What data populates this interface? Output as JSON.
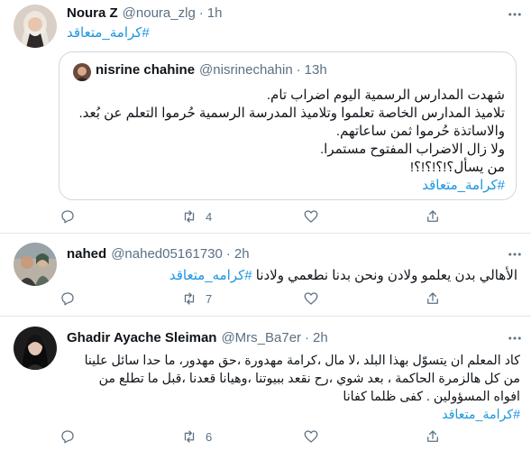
{
  "tweets": [
    {
      "name": "Noura Z",
      "handle": "@noura_zlg",
      "dot": "·",
      "time": "1h",
      "text": "#كرامة_متعاقد",
      "quote": {
        "name": "nisrine chahine",
        "handle": "@nisrinechahin",
        "dot": "·",
        "time": "13h",
        "lines": [
          "شهدت المدارس الرسمية اليوم اضراب تام.",
          "تلاميذ المدارس الخاصة تعلموا وتلاميذ المدرسة الرسمية حُرموا التعلم عن بُعد.",
          "والاساتذة حُرموا ثمن ساعاتهم.",
          "ولا زال الاضراب المفتوح مستمرا.",
          "من يسأل؟!؟!؟!؟!",
          "#كرامة_متعاقد"
        ]
      },
      "actions": {
        "reply_count": "",
        "retweet_count": "4",
        "like_count": ""
      }
    },
    {
      "name": "nahed",
      "handle": "@nahed05161730",
      "dot": "·",
      "time": "2h",
      "text_plain": "الأهالي بدن يعلمو ولادن ونحن بدنا نطعمي ولادنا ",
      "hashtag": "#كرامه_متعاقد",
      "actions": {
        "reply_count": "",
        "retweet_count": "7",
        "like_count": ""
      }
    },
    {
      "name": "Ghadir Ayache Sleiman",
      "handle": "@Mrs_Ba7er",
      "dot": "·",
      "time": "2h",
      "lines": [
        "كاد المعلم ان يتسوّل بهذا البلد ،لا مال ،كرامة مهدورة ،حق مهدور، ما حدا سائل علينا",
        "من كل هالزمرة الحاكمة ، بعد شوي ،رح نقعد ببيوتنا ،وهيانا قعدنا ،قبل ما تطلع من",
        "افواه المسؤولين . كفى ظلما كفانا"
      ],
      "hashtag": "#كرامة_متعاقد",
      "actions": {
        "reply_count": "",
        "retweet_count": "6",
        "like_count": ""
      }
    }
  ],
  "colors": {
    "accent": "#1b95e0",
    "muted": "#5b7083",
    "border": "#cfd9de"
  }
}
